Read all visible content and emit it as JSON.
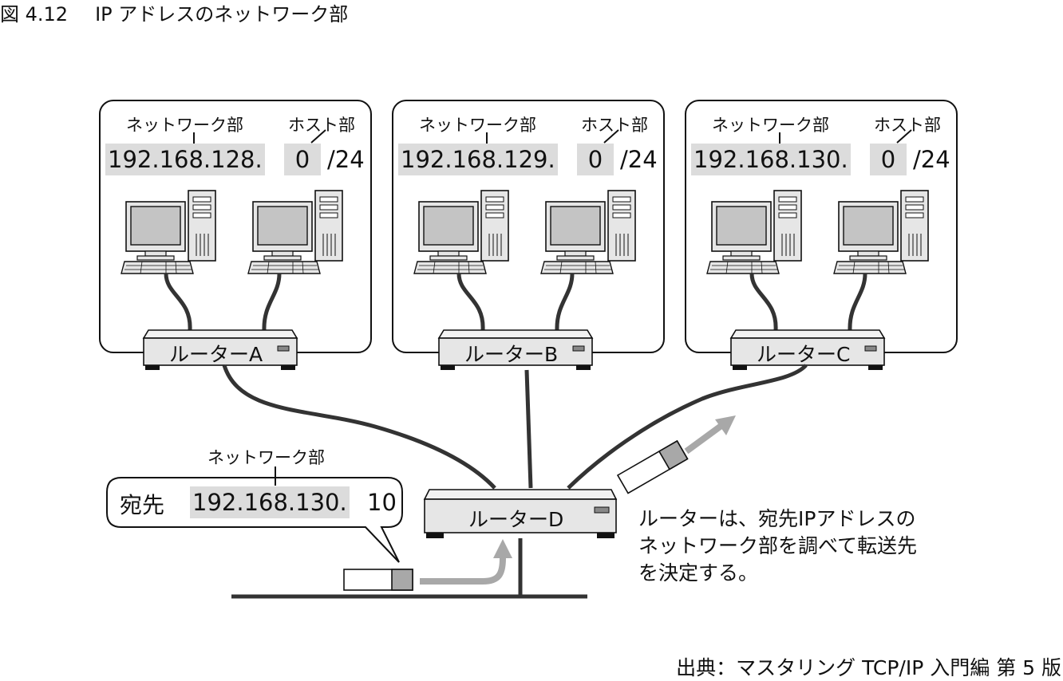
{
  "figure": {
    "number": "図 4.12",
    "caption": "IP アドレスのネットワーク部"
  },
  "networks": [
    {
      "network_label": "ネットワーク部",
      "host_label": "ホスト部",
      "ip_network": "192.168.128.",
      "ip_host": "0",
      "mask": "/24",
      "router": "ルーターA"
    },
    {
      "network_label": "ネットワーク部",
      "host_label": "ホスト部",
      "ip_network": "192.168.129.",
      "ip_host": "0",
      "mask": "/24",
      "router": "ルーターB"
    },
    {
      "network_label": "ネットワーク部",
      "host_label": "ホスト部",
      "ip_network": "192.168.130.",
      "ip_host": "0",
      "mask": "/24",
      "router": "ルーターC"
    }
  ],
  "main_router": "ルーターD",
  "packet": {
    "network_label": "ネットワーク部",
    "dest_label": "宛先",
    "ip_network": "192.168.130.",
    "ip_host": "10"
  },
  "explanation": "ルーターは、宛先IPアドレスのネットワーク部を調べて転送先を決定する。",
  "source_credit": "出典：マスタリング TCP/IP 入門編 第 5 版",
  "colors": {
    "band": "#dcdcdc",
    "arrow": "#a8a8a8",
    "line": "#333333",
    "device": "#e6e6e6"
  }
}
